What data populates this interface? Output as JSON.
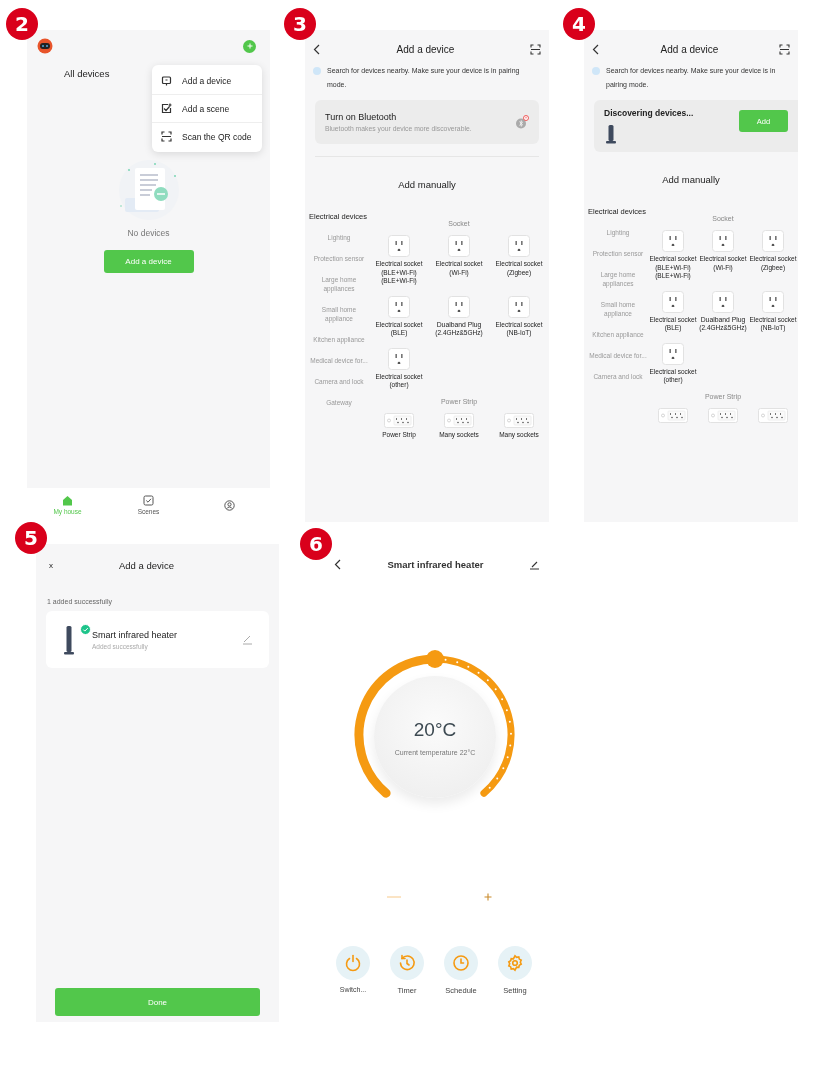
{
  "panels": [
    {
      "kind": "home",
      "badge": "2",
      "title": "All devices",
      "menu": [
        {
          "label": "Add a device"
        },
        {
          "label": "Add a scene"
        },
        {
          "label": "Scan the QR code"
        }
      ],
      "empty_text": "No devices",
      "button": "Add a device",
      "nav": [
        {
          "label": "My house",
          "selected": true
        },
        {
          "label": "Scenes",
          "selected": false
        },
        {
          "selected": false
        }
      ]
    },
    {
      "kind": "add_device",
      "badge": "3",
      "title": "Add a device",
      "hint": "Search for devices nearby. Make sure your device is in pairing mode.",
      "banner": {
        "kind": "bluetooth",
        "title": "Turn on Bluetooth",
        "subtitle": "Bluetooth makes your device more discoverable."
      },
      "section_title": "Add manually",
      "categories": [
        {
          "label": "Electrical devices",
          "selected": true
        },
        {
          "label": "Lighting",
          "selected": false
        },
        {
          "label": "Protection sensor",
          "selected": false
        },
        {
          "label": "Large home appliances",
          "selected": false
        },
        {
          "label": "Small home appliance",
          "selected": false
        },
        {
          "label": "Kitchen appliance",
          "selected": false
        },
        {
          "label": "Medical device for...",
          "selected": false
        },
        {
          "label": "Camera and lock",
          "selected": false
        },
        {
          "label": "Gateway",
          "selected": false
        }
      ],
      "groups": [
        {
          "title": "Socket",
          "kind": "socket",
          "items": [
            {
              "name": "Electrical socket",
              "detail": "(BLE+Wi-Fi)\n(BLE+Wi-Fi)"
            },
            {
              "name": "Electrical socket",
              "detail": "(Wi-Fi)"
            },
            {
              "name": "Electrical socket",
              "detail": "(Zigbee)"
            },
            {
              "name": "Electrical socket",
              "detail": "(BLE)"
            },
            {
              "name": "Dualband Plug",
              "detail": "(2.4GHz&5GHz)"
            },
            {
              "name": "Electrical socket",
              "detail": "(NB-IoT)"
            },
            {
              "name": "Electrical socket",
              "detail": "(other)"
            }
          ]
        },
        {
          "title": "Power Strip",
          "kind": "strip",
          "items": [
            {
              "name": "Power Strip"
            },
            {
              "name": "Many sockets"
            },
            {
              "name": "Many sockets"
            }
          ]
        }
      ]
    },
    {
      "kind": "add_device",
      "badge": "4",
      "title": "Add a device",
      "hint": "Search for devices nearby. Make sure your device is in pairing mode.",
      "banner": {
        "kind": "discovering",
        "title": "Discovering devices...",
        "button": "Add"
      },
      "section_title": "Add manually",
      "categories": [
        {
          "label": "Electrical devices",
          "selected": true
        },
        {
          "label": "Lighting",
          "selected": false
        },
        {
          "label": "Protection sensor",
          "selected": false
        },
        {
          "label": "Large home appliances",
          "selected": false
        },
        {
          "label": "Small home appliance",
          "selected": false
        },
        {
          "label": "Kitchen appliance",
          "selected": false
        },
        {
          "label": "Medical device for...",
          "selected": false
        },
        {
          "label": "Camera and lock",
          "selected": false
        }
      ],
      "groups": [
        {
          "title": "Socket",
          "kind": "socket",
          "items": [
            {
              "name": "Electrical socket",
              "detail": "(BLE+Wi-Fi)\n(BLE+Wi-Fi)"
            },
            {
              "name": "Electrical socket",
              "detail": "(Wi-Fi)"
            },
            {
              "name": "Electrical socket",
              "detail": "(Zigbee)"
            },
            {
              "name": "Electrical socket",
              "detail": "(BLE)"
            },
            {
              "name": "Dualband Plug",
              "detail": "(2.4GHz&5GHz)"
            },
            {
              "name": "Electrical socket",
              "detail": "(NB-IoT)"
            },
            {
              "name": "Electrical socket",
              "detail": "(other)"
            }
          ]
        },
        {
          "title": "Power Strip",
          "kind": "strip"
        }
      ]
    },
    {
      "kind": "added",
      "badge": "5",
      "close": "x",
      "title": "Add a device",
      "summary": "1 added successfully",
      "devices": [
        {
          "name": "Smart infrared heater",
          "status": "Added successfully"
        }
      ],
      "button": "Done"
    },
    {
      "kind": "control",
      "badge": "6",
      "title": "Smart infrared heater",
      "dial": {
        "value": "20°C",
        "current": "Current temperature 22°C",
        "level": 0.5
      },
      "actions": [
        {
          "label": "Switch..."
        },
        {
          "label": "Timer"
        },
        {
          "label": "Schedule"
        },
        {
          "label": "Setting"
        }
      ]
    }
  ]
}
